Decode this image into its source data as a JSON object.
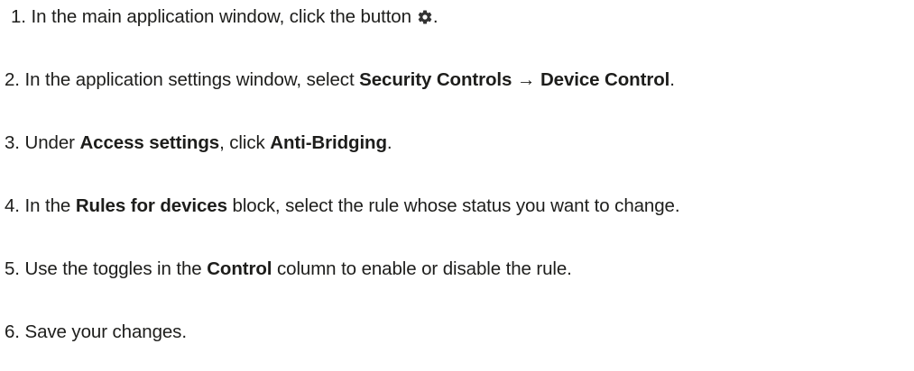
{
  "steps": [
    {
      "number": "1.",
      "text_before": "In the main application window, click the button",
      "icon": "gear-icon",
      "text_after": "."
    },
    {
      "number": "2.",
      "text_before": "In the application settings window, select",
      "bold_1": "Security Controls",
      "arrow": "→",
      "bold_2": "Device Control",
      "text_after": "."
    },
    {
      "number": "3.",
      "text_before": "Under",
      "bold_1": "Access settings",
      "text_middle": ", click",
      "bold_2": "Anti-Bridging",
      "text_after": "."
    },
    {
      "number": "4.",
      "text_before": "In the",
      "bold_1": "Rules for devices",
      "text_after": "block, select the rule whose status you want to change."
    },
    {
      "number": "5.",
      "text_before": "Use the toggles in the",
      "bold_1": "Control",
      "text_after": "column to enable or disable the rule."
    },
    {
      "number": "6.",
      "text_before": "Save your changes."
    }
  ],
  "colors": {
    "text": "#1d1d1b",
    "icon": "#333333",
    "background": "#ffffff"
  }
}
